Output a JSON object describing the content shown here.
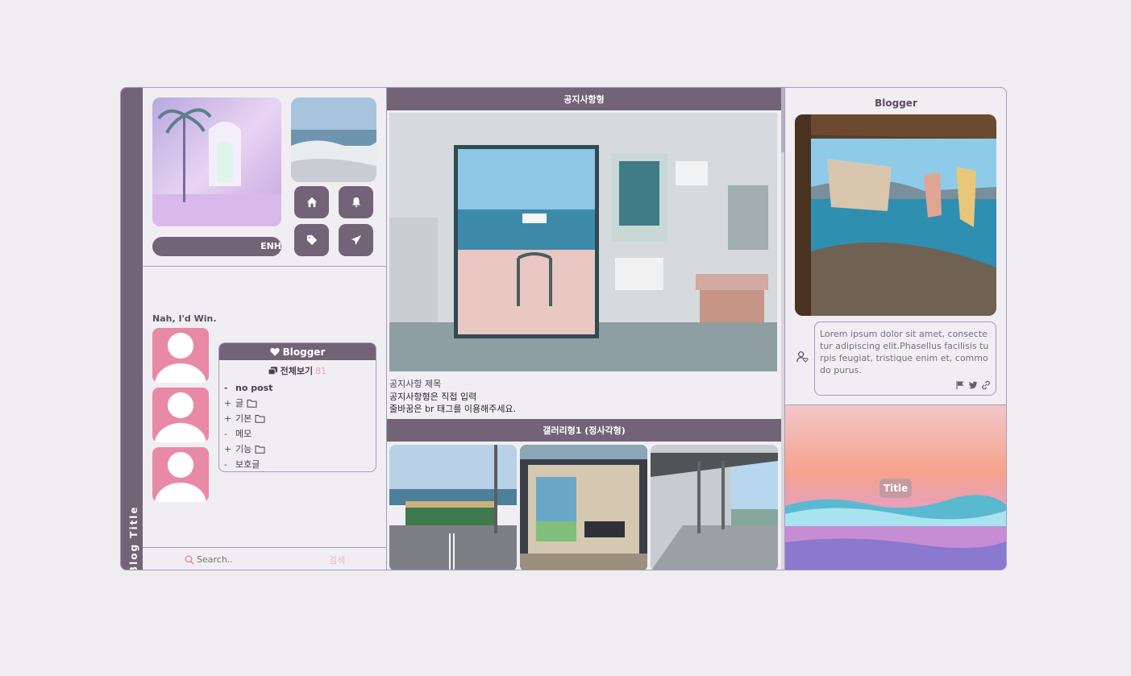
{
  "sidebar": {
    "blog_title": "Blog Title"
  },
  "profile": {
    "enh_label": "ENH",
    "nickname": "Nah, I'd Win."
  },
  "quick_buttons": [
    {
      "name": "home-icon"
    },
    {
      "name": "bell-icon"
    },
    {
      "name": "tag-icon"
    },
    {
      "name": "paper-plane-icon"
    }
  ],
  "category": {
    "header": "Blogger",
    "all_label": "전체보기",
    "all_count": "81",
    "items": [
      {
        "prefix": "-",
        "label": "no post",
        "bold": true,
        "folder": false
      },
      {
        "prefix": "+",
        "label": "글",
        "bold": false,
        "folder": true
      },
      {
        "prefix": "+",
        "label": "기본",
        "bold": false,
        "folder": true
      },
      {
        "prefix": "-",
        "label": "메모",
        "bold": false,
        "folder": false
      },
      {
        "prefix": "+",
        "label": "기능",
        "bold": false,
        "folder": true
      },
      {
        "prefix": "-",
        "label": "보호글",
        "bold": false,
        "folder": false
      }
    ]
  },
  "search": {
    "placeholder": "Search..",
    "button": "검색"
  },
  "notice": {
    "header": "공지사항형",
    "title": "공지사항 제목",
    "line1": "공지사항형은 직접 입력",
    "line2": "줄바꿈은 br 태그를 이용해주세요."
  },
  "gallery": {
    "header": "갤러리형1 (정사각형)"
  },
  "right": {
    "title": "Blogger",
    "bio": "Lorem ipsum dolor sit amet, consectetur adipiscing elit.Phasellus facilisis turpis feugiat, tristique enim et, commodo purus.",
    "image_title": "Title"
  },
  "colors": {
    "accent": "#726377",
    "pink": "#e88aa6",
    "border": "#a79bbd",
    "background": "#efedf0"
  }
}
